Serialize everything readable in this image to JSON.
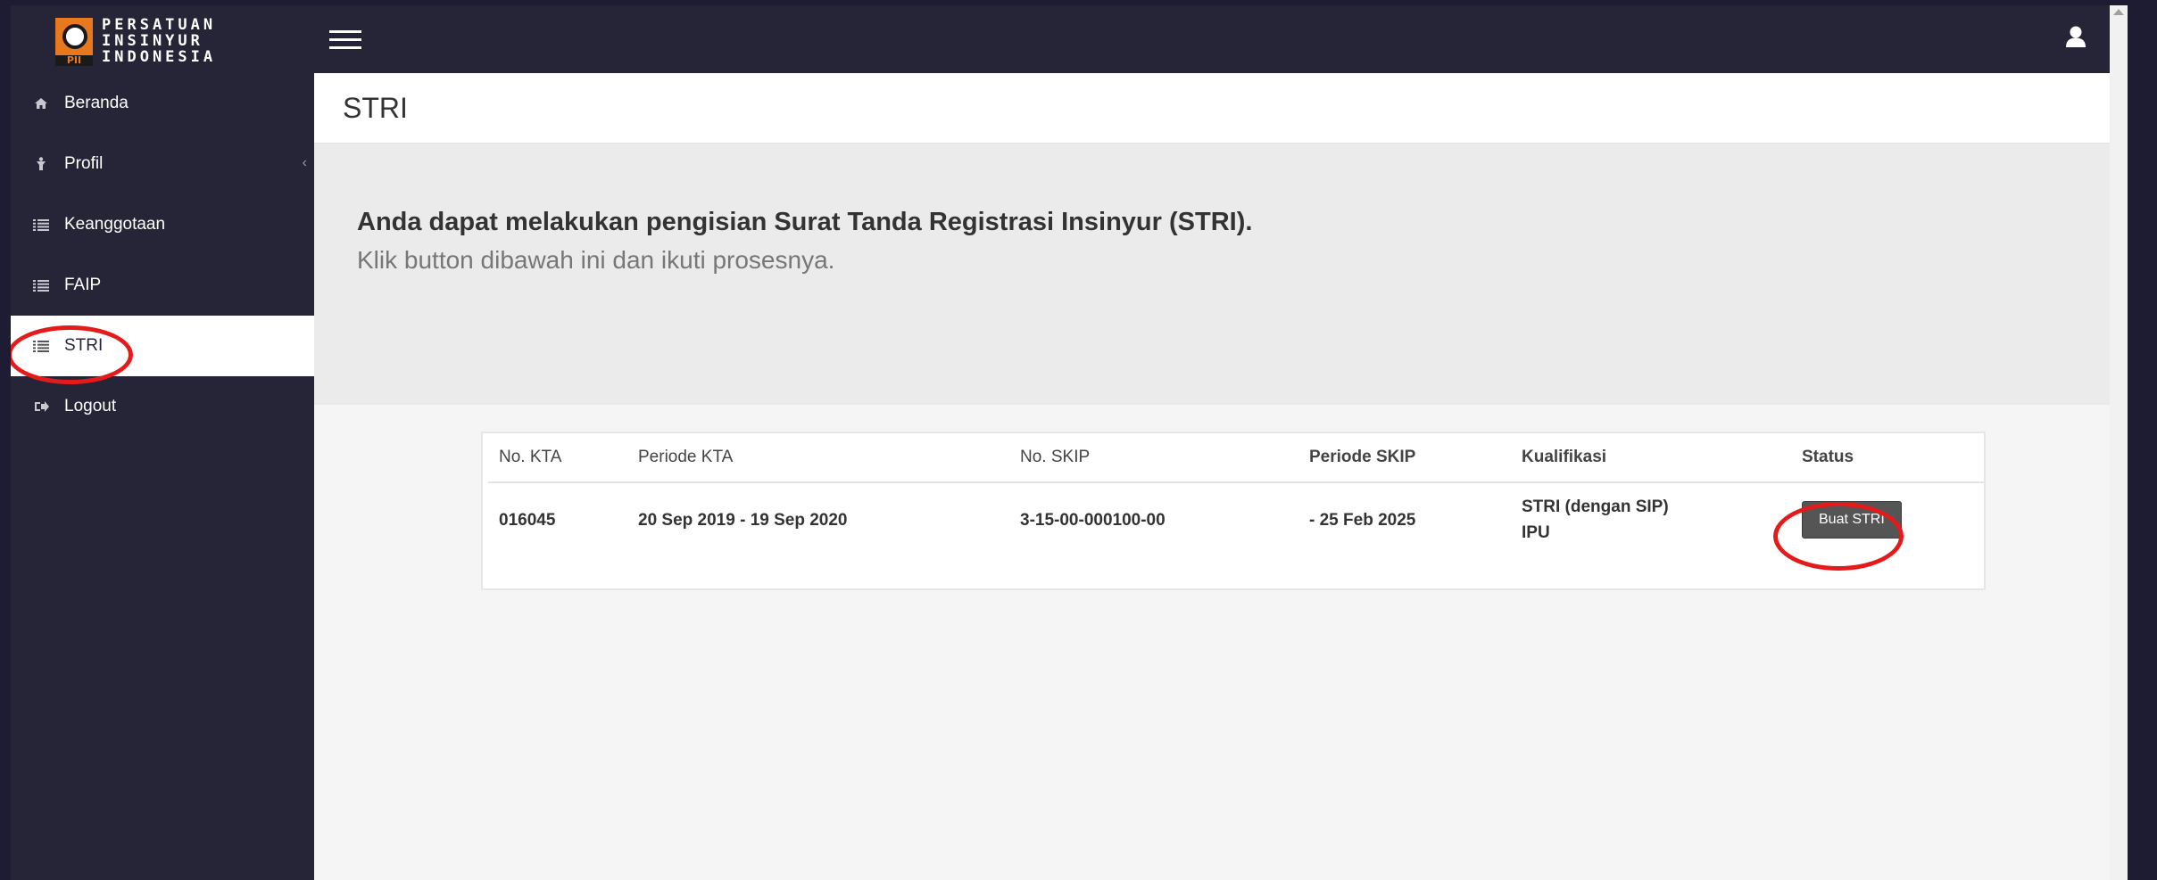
{
  "logo": {
    "mark_text": "PII",
    "lines": [
      "PERSATUAN",
      "INSINYUR",
      "INDONESIA"
    ]
  },
  "sidebar": {
    "items": [
      {
        "label": "Beranda",
        "icon": "home-icon"
      },
      {
        "label": "Profil",
        "icon": "user-figure-icon"
      },
      {
        "label": "Keanggotaan",
        "icon": "list-icon"
      },
      {
        "label": "FAIP",
        "icon": "list-icon"
      },
      {
        "label": "STRI",
        "icon": "list-icon"
      },
      {
        "label": "Logout",
        "icon": "logout-icon"
      }
    ]
  },
  "page": {
    "title": "STRI",
    "heading": "Anda dapat melakukan pengisian Surat Tanda Registrasi Insinyur (STRI).",
    "subheading": "Klik button dibawah ini dan ikuti prosesnya."
  },
  "table": {
    "headers": [
      "No. KTA",
      "Periode KTA",
      "No. SKIP",
      "Periode SKIP",
      "Kualifikasi",
      "Status"
    ],
    "row": {
      "no_kta": "016045",
      "periode_kta": "20 Sep 2019 - 19 Sep 2020",
      "no_skip": "3-15-00-000100-00",
      "periode_skip": "- 25 Feb 2025",
      "kualifikasi_1": "STRI (dengan SIP)",
      "kualifikasi_2": "IPU",
      "button": "Buat STRI"
    }
  },
  "colors": {
    "topbar": "#252537",
    "brand_orange": "#e8781d",
    "annotation": "#e31b1b",
    "button": "#555555"
  }
}
